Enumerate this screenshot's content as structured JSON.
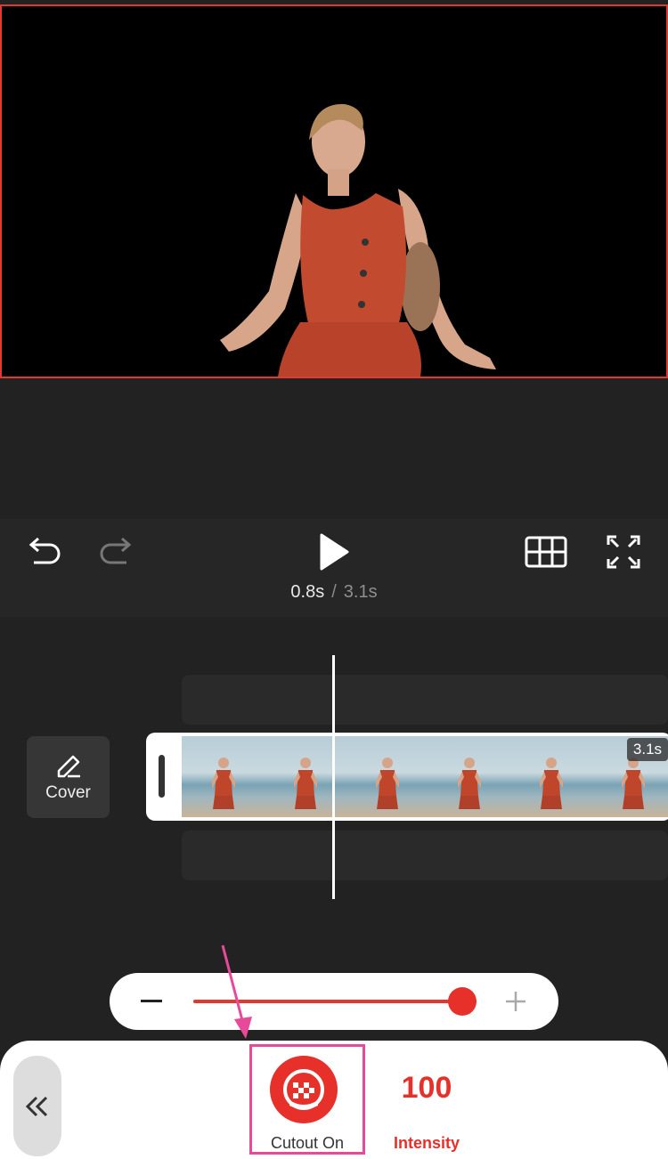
{
  "playback": {
    "current_time": "0.8s",
    "separator": "/",
    "total_time": "3.1s"
  },
  "timeline": {
    "cover_label": "Cover",
    "clip_duration": "3.1s",
    "frame_count": 6
  },
  "slider": {
    "value": 100,
    "max": 100
  },
  "bottom_panel": {
    "cutout_label": "Cutout On",
    "intensity_value": "100",
    "intensity_label": "Intensity"
  },
  "icons": {
    "undo": "undo-icon",
    "redo": "redo-icon",
    "play": "play-icon",
    "grid": "grid-icon",
    "fullscreen": "fullscreen-icon",
    "edit": "pencil-icon",
    "back": "double-chevron-left-icon",
    "cutout": "cutout-icon"
  },
  "colors": {
    "accent": "#e8302a",
    "highlight": "#e84a9a",
    "background": "#222222"
  }
}
